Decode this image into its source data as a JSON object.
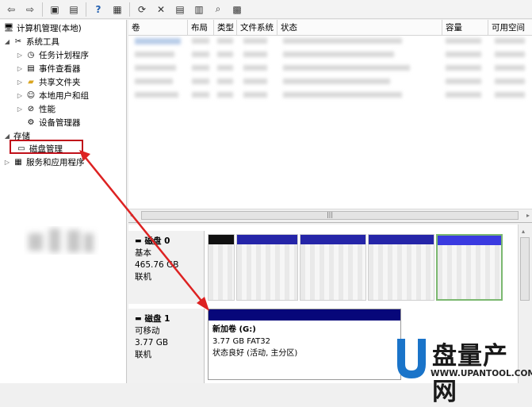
{
  "toolbar": {
    "buttons": [
      "back-icon",
      "forward-icon",
      "up-folder-icon",
      "show-hide-tree-icon",
      "help-icon",
      "properties-panel-icon",
      "refresh-icon",
      "delete-icon",
      "properties-icon",
      "open-icon",
      "search-icon",
      "export-icon"
    ],
    "glyphs": [
      "⇦",
      "⇨",
      "▣",
      "▤",
      "?",
      "▦",
      "⟳",
      "✕",
      "▤",
      "▥",
      "⌕",
      "▩"
    ]
  },
  "tree": {
    "root": "计算机管理(本地)",
    "system_tools": "系统工具",
    "task_scheduler": "任务计划程序",
    "event_viewer": "事件查看器",
    "shared_folders": "共享文件夹",
    "local_users": "本地用户和组",
    "performance": "性能",
    "device_manager": "设备管理器",
    "storage": "存储",
    "disk_management": "磁盘管理",
    "services_apps": "服务和应用程序"
  },
  "columns": [
    "卷",
    "布局",
    "类型",
    "文件系统",
    "状态",
    "容量",
    "可用空间"
  ],
  "disk0": {
    "title": "磁盘 0",
    "type": "基本",
    "size": "465.76 GB",
    "status": "联机"
  },
  "disk1": {
    "title": "磁盘 1",
    "type": "可移动",
    "size": "3.77 GB",
    "status": "联机",
    "volume": {
      "name": "新加卷  (G:)",
      "detail": "3.77 GB FAT32",
      "state": "状态良好 (活动, 主分区)"
    }
  },
  "logo": {
    "brand": "盘量产网",
    "url": "WWW.UPANTOOL.COM",
    "letter": "U"
  },
  "colors": {
    "highlight": "#c0101a",
    "partition_bar": "#2525a8",
    "usb_bar": "#07077a",
    "logo_blue": "#1a74c9"
  }
}
